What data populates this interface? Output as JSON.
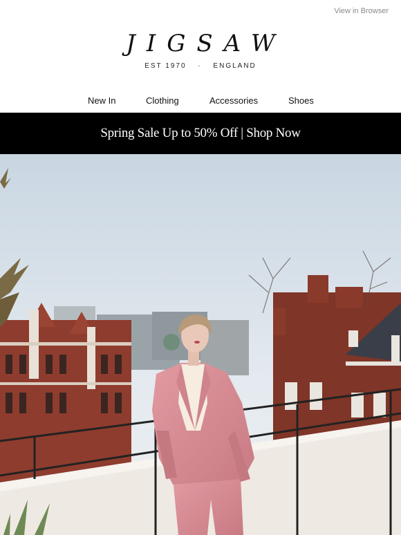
{
  "header": {
    "view_in_browser": "View in Browser",
    "logo": "JIGSAW",
    "tagline_left": "EST 1970",
    "tagline_sep": "·",
    "tagline_right": "ENGLAND"
  },
  "nav": {
    "items": [
      "New In",
      "Clothing",
      "Accessories",
      "Shoes"
    ]
  },
  "banner": {
    "text": "Spring Sale Up to 50% Off | Shop Now"
  },
  "colors": {
    "banner_bg": "#000000",
    "suit_pink": "#d98b92",
    "sky": "#dfe7ee",
    "brick": "#8e3c2e"
  }
}
